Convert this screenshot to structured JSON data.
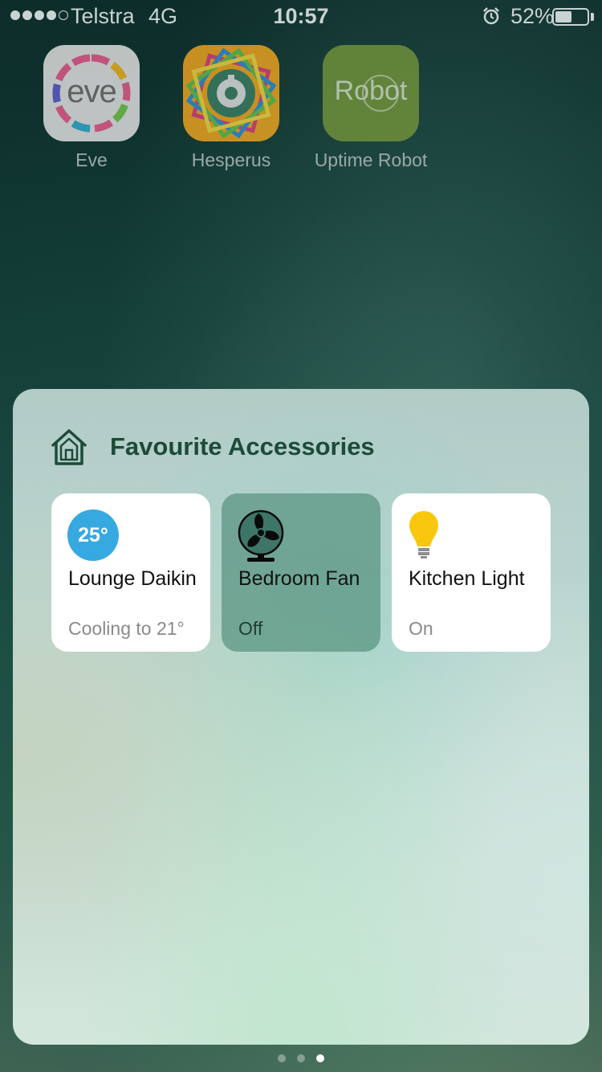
{
  "status_bar": {
    "carrier": "Telstra",
    "network": "4G",
    "time": "10:57",
    "battery_percent": "52%",
    "battery_level": 0.52,
    "signal_bars": 4,
    "signal_total": 5
  },
  "apps": [
    {
      "label": "Eve",
      "icon_text": "eve",
      "icon": "eve-app-icon"
    },
    {
      "label": "Hesperus",
      "icon": "hesperus-app-icon"
    },
    {
      "label": "Uptime Robot",
      "icon_text": "Robot",
      "icon": "uptime-robot-app-icon"
    }
  ],
  "widget": {
    "title": "Favourite Accessories",
    "icon": "home-icon",
    "tiles": [
      {
        "name": "Lounge Daikin",
        "status": "Cooling to 21°",
        "badge": "25°",
        "state": "on",
        "icon": "thermostat-icon",
        "badge_color": "#36a9e1"
      },
      {
        "name": "Bedroom Fan",
        "status": "Off",
        "state": "off",
        "icon": "fan-icon"
      },
      {
        "name": "Kitchen Light",
        "status": "On",
        "state": "on",
        "icon": "light-bulb-icon",
        "bulb_color": "#f9c80e"
      }
    ]
  },
  "page_indicator": {
    "count": 3,
    "active_index": 2
  },
  "colors": {
    "title_green": "#1d4a39",
    "thermostat_blue": "#36a9e1",
    "bulb_yellow": "#f9c80e"
  }
}
